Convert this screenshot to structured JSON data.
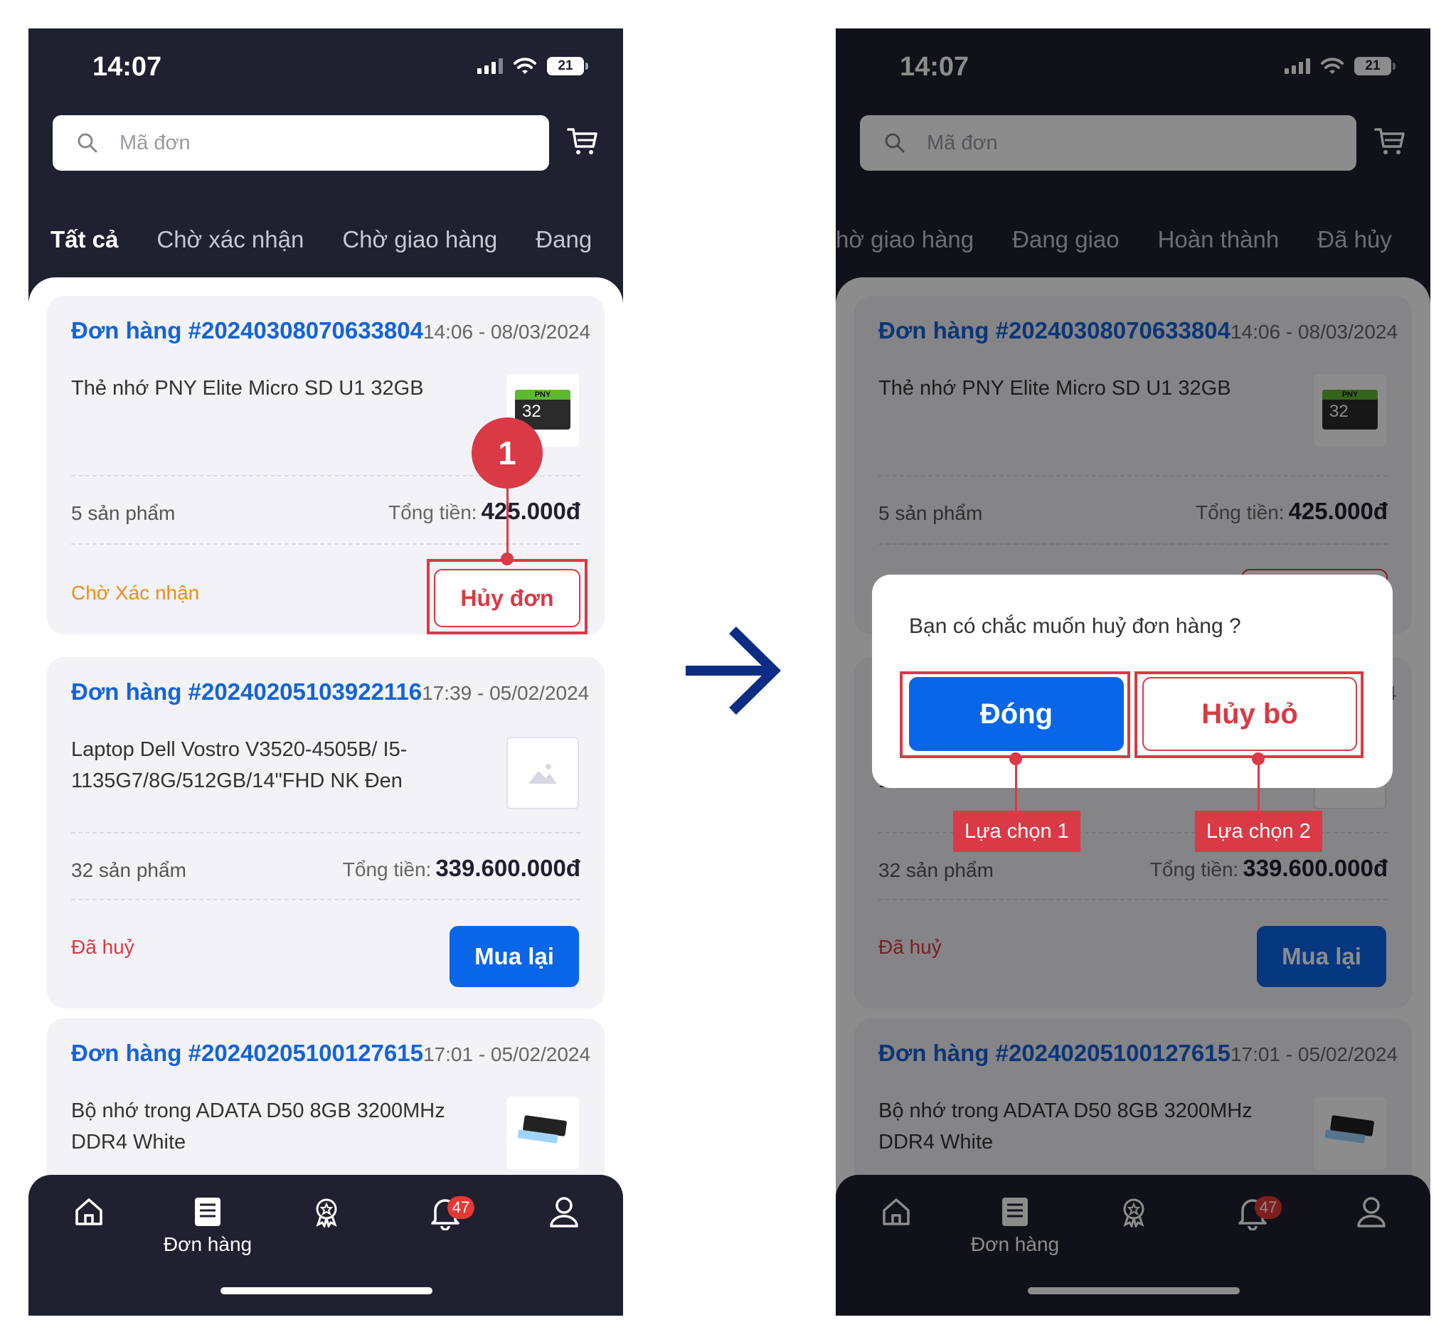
{
  "status": {
    "time": "14:07",
    "battery": "21"
  },
  "search": {
    "placeholder": "Mã đơn"
  },
  "tabs_left": [
    "Tất cả",
    "Chờ xác nhận",
    "Chờ giao hàng",
    "Đang"
  ],
  "tabs_right": [
    "hờ giao hàng",
    "Đang giao",
    "Hoàn thành",
    "Đã hủy"
  ],
  "orders": [
    {
      "code": "Đơn hàng #20240308070633804",
      "time": "14:06 - 08/03/2024",
      "product": "Thẻ nhớ PNY Elite Micro SD U1 32GB",
      "quantity": "5 sản phẩm",
      "total_label": "Tổng tiền:",
      "total": "425.000đ",
      "status": "Chờ Xác nhận",
      "action": "Hủy đơn",
      "thumb_brand": "PNY",
      "thumb_capacity": "32"
    },
    {
      "code": "Đơn hàng #20240205103922116",
      "time": "17:39 - 05/02/2024",
      "product": "Laptop Dell Vostro V3520-4505B/ I5-1135G7/8G/512GB/14\"FHD NK Đen",
      "quantity": "32 sản phẩm",
      "total_label": "Tổng tiền:",
      "total": "339.600.000đ",
      "status": "Đã huỷ",
      "action": "Mua lại"
    },
    {
      "code": "Đơn hàng #20240205100127615",
      "time": "17:01 - 05/02/2024",
      "product": "Bộ nhớ trong ADATA D50 8GB 3200MHz DDR4 White"
    }
  ],
  "nav": {
    "orders_label": "Đơn hàng",
    "badge": "47"
  },
  "dialog": {
    "message": "Bạn có chắc muốn huỷ đơn hàng ?",
    "close": "Đóng",
    "cancel": "Hủy bỏ"
  },
  "annotations": {
    "step": "1",
    "option1": "Lựa chọn 1",
    "option2": "Lựa chọn 2"
  },
  "colors": {
    "brand_blue": "#0a66e8",
    "order_code": "#1463d9",
    "danger": "#d93a45",
    "pending": "#e8901a",
    "dark_bg": "#1f2030"
  }
}
